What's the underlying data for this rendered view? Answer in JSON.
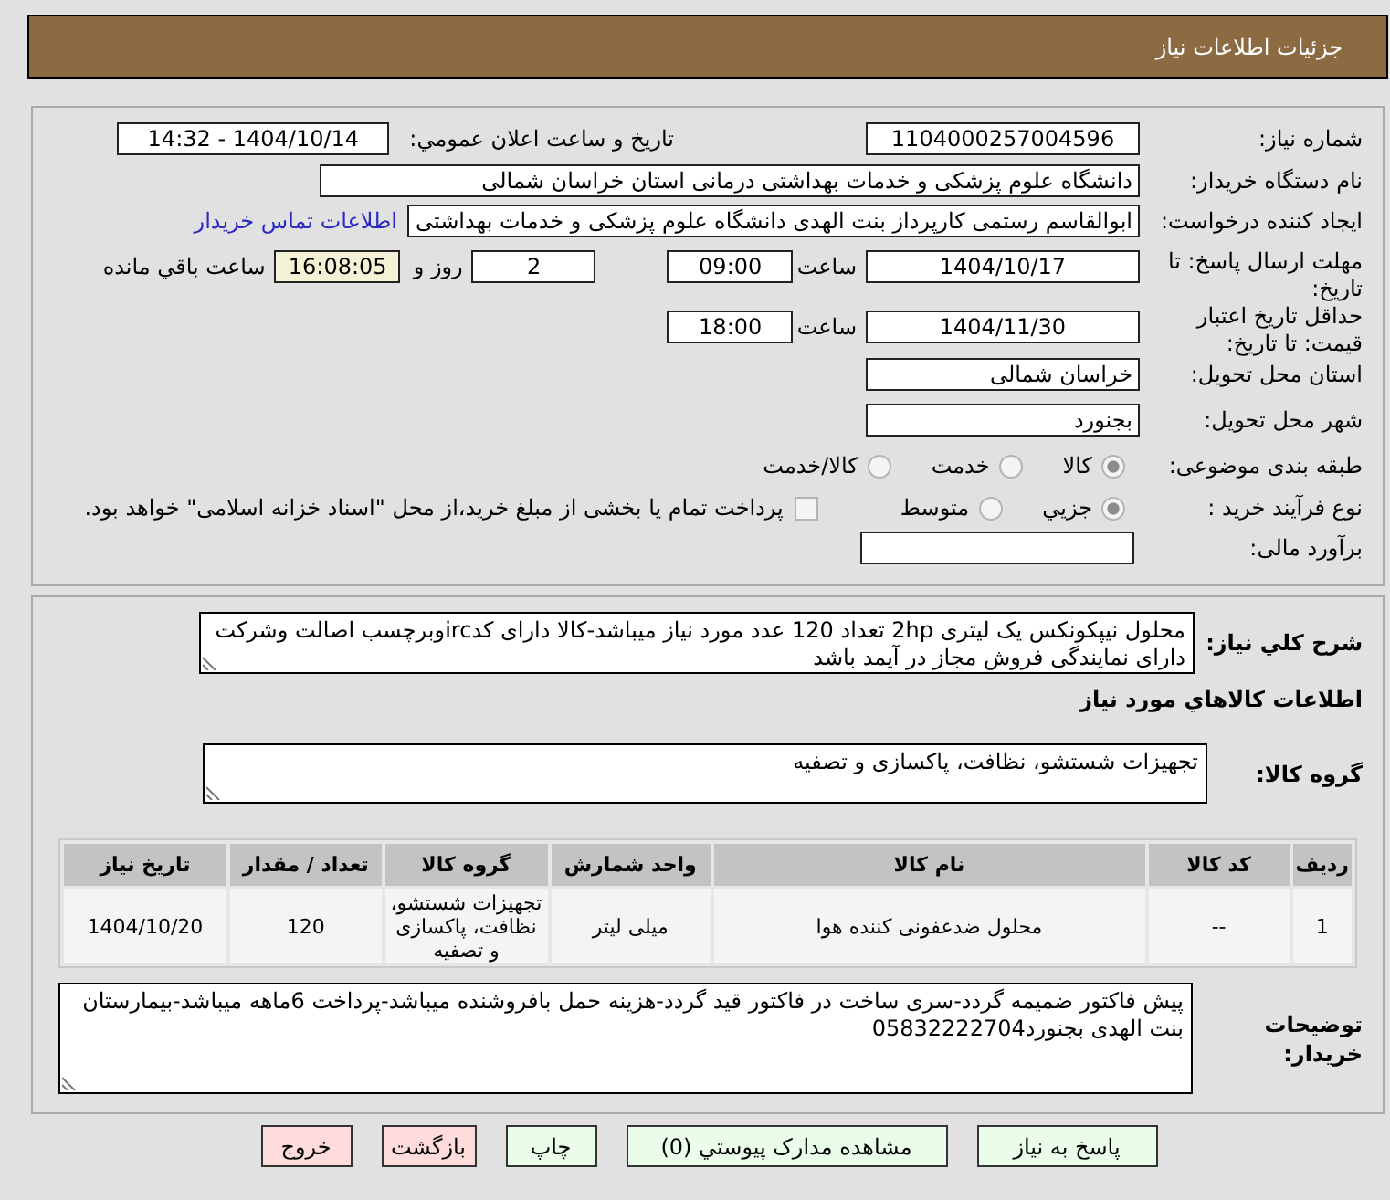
{
  "header": {
    "title": "جزئیات اطلاعات نیاز"
  },
  "details": {
    "need_number": {
      "label": "شماره نیاز:",
      "value": "1104000257004596"
    },
    "announced": {
      "label": "تاریخ و ساعت اعلان عمومي:",
      "value": "1404/10/14 - 14:32"
    },
    "buyer": {
      "label": "نام دستگاه خریدار:",
      "value": "دانشگاه علوم پزشکی و خدمات بهداشتی درمانی استان خراسان شمالی"
    },
    "requester": {
      "label": "ایجاد کننده درخواست:",
      "value": "ابوالقاسم رستمی کارپرداز بنت الهدی دانشگاه علوم پزشکی و خدمات بهداشتی",
      "contact_link": "اطلاعات تماس خریدار"
    },
    "reply_deadline": {
      "label": "مهلت ارسال پاسخ: تا تاریخ:",
      "date": "1404/10/17",
      "time_label": "ساعت",
      "time": "09:00",
      "days": "2",
      "days_label": "روز و",
      "remaining": "16:08:05",
      "remaining_label": "ساعت باقي مانده"
    },
    "price_validity": {
      "label": "حداقل تاریخ اعتبار قیمت: تا تاریخ:",
      "date": "1404/11/30",
      "time_label": "ساعت",
      "time": "18:00"
    },
    "province": {
      "label": "استان محل تحویل:",
      "value": "خراسان شمالی"
    },
    "city": {
      "label": "شهر محل تحویل:",
      "value": "بجنورد"
    },
    "category": {
      "label": "طبقه بندی موضوعی:",
      "options": [
        {
          "label": "کالا",
          "selected": true
        },
        {
          "label": "خدمت",
          "selected": false
        },
        {
          "label": "کالا/خدمت",
          "selected": false
        }
      ]
    },
    "process": {
      "label": "نوع فرآیند خرید :",
      "options": [
        {
          "label": "جزیي",
          "selected": true
        },
        {
          "label": "متوسط",
          "selected": false
        }
      ],
      "treasury": {
        "label": "پرداخت تمام یا بخشی از مبلغ خرید،از محل \"اسناد خزانه اسلامی\" خواهد بود.",
        "checked": false
      }
    },
    "estimate": {
      "label": "برآورد مالی:"
    }
  },
  "description": {
    "label": "شرح کلي نياز:",
    "text": "محلول نیپکونکس یک لیتری 2hp تعداد 120 عدد مورد نیاز میباشد-کالا دارای کدircوبرچسب اصالت وشرکت دارای نمایندگی فروش مجاز در آیمد باشد"
  },
  "goods": {
    "title": "اطلاعات کالاهاي مورد نياز",
    "group_label": "گروه کالا:",
    "group": "تجهیزات شستشو، نظافت، پاکسازی و تصفیه",
    "table": {
      "columns": [
        "ردیف",
        "کد کالا",
        "نام کالا",
        "واحد شمارش",
        "گروه کالا",
        "تعداد / مقدار",
        "تاریخ نیاز"
      ],
      "rows": [
        [
          "1",
          "--",
          "محلول ضدعفونی کننده هوا",
          "میلی لیتر",
          "تجهیزات شستشو، نظافت، پاکسازی و تصفیه",
          "120",
          "1404/10/20"
        ]
      ]
    }
  },
  "notes": {
    "label": "توضیحات خریدار:",
    "text": "پیش فاکتور ضمیمه گردد-سری ساخت در فاکتور قید گردد-هزینه حمل بافروشنده میباشد-پرداخت 6ماهه میباشد-بیمارستان بنت الهدی بجنورد05832222704"
  },
  "buttons": [
    {
      "label": "پاسخ به نیاز",
      "kind": "action"
    },
    {
      "label": "مشاهده مدارک پیوستي (0)",
      "kind": "action"
    },
    {
      "label": "چاپ",
      "kind": "action"
    },
    {
      "label": "بازگشت",
      "kind": "cancel"
    },
    {
      "label": "خروج",
      "kind": "cancel"
    }
  ]
}
